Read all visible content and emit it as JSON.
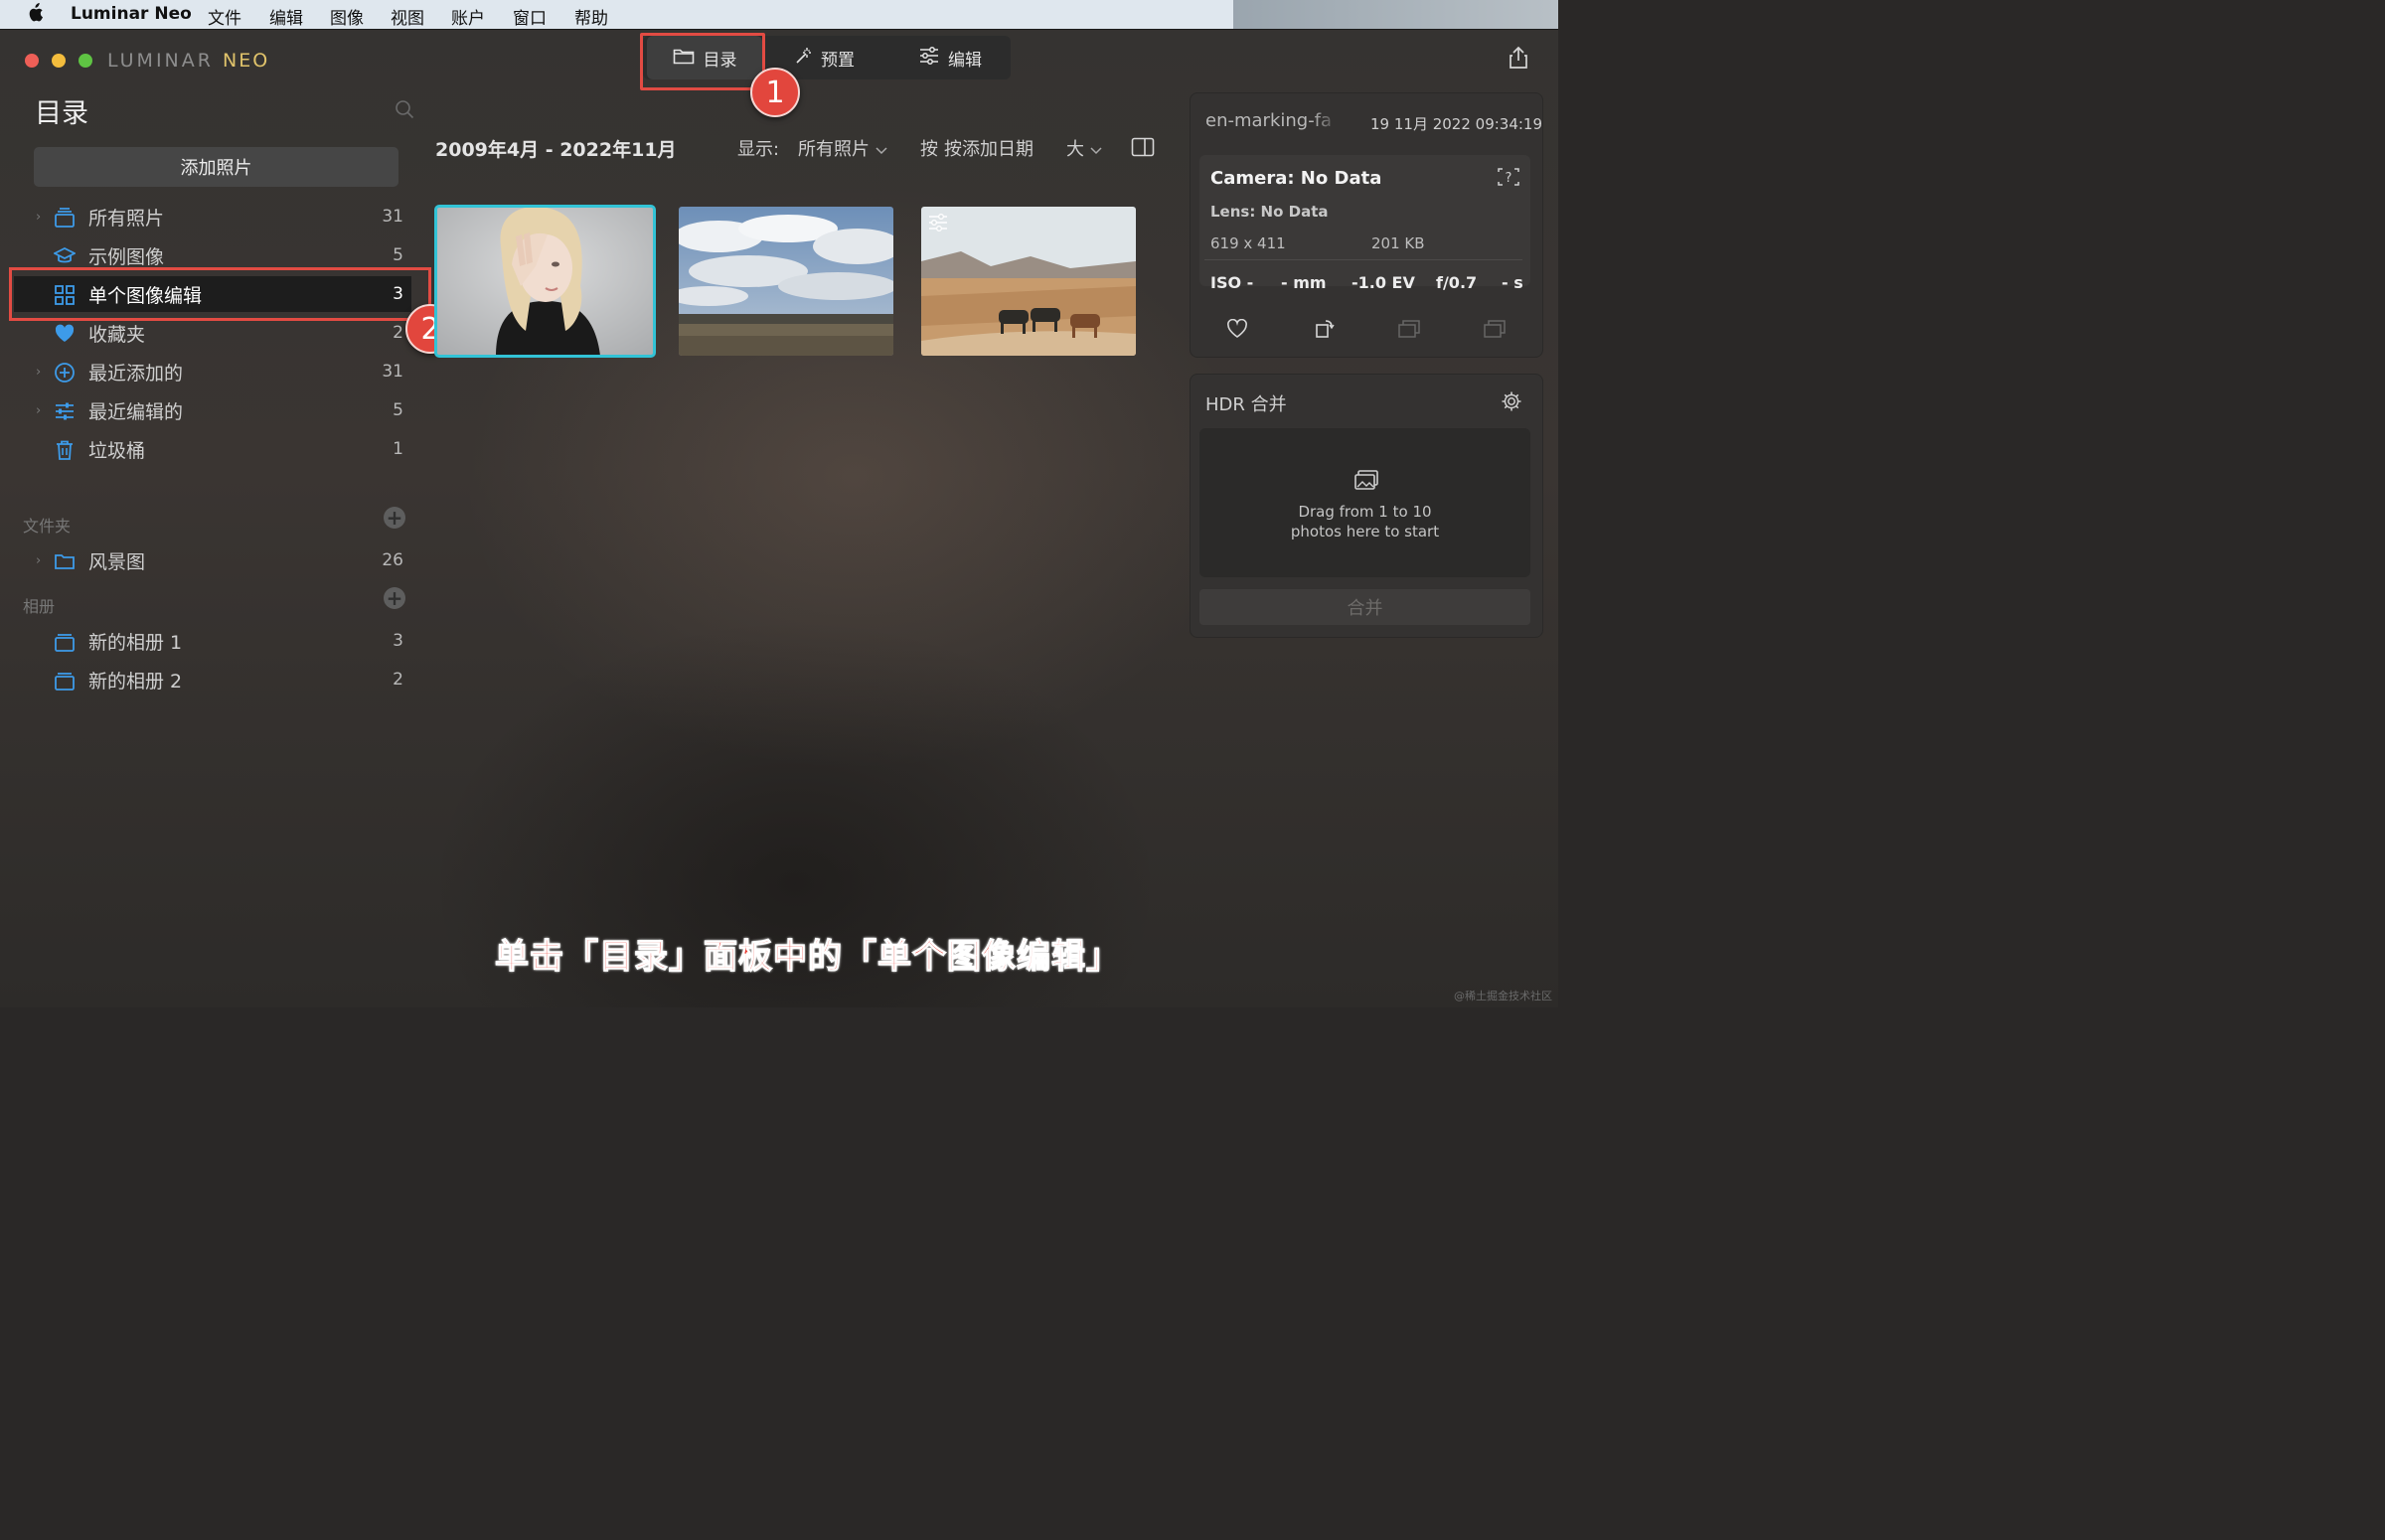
{
  "menubar": {
    "app": "Luminar Neo",
    "items": [
      "文件",
      "编辑",
      "图像",
      "视图",
      "账户",
      "窗口",
      "帮助"
    ]
  },
  "logo": {
    "part1": "LUMINAR ",
    "part2": "NEO"
  },
  "tabs": [
    {
      "label": "目录",
      "icon": "folder-icon",
      "active": true
    },
    {
      "label": "预置",
      "icon": "magic-wand-icon",
      "active": false
    },
    {
      "label": "编辑",
      "icon": "sliders-icon",
      "active": false
    }
  ],
  "annotations": {
    "badge1": "1",
    "badge2": "2"
  },
  "sidebar": {
    "title": "目录",
    "add_button": "添加照片",
    "items": [
      {
        "label": "所有照片",
        "count": "31",
        "icon": "photos-stack-icon",
        "has_chevron": true
      },
      {
        "label": "示例图像",
        "count": "5",
        "icon": "graduation-cap-icon",
        "has_chevron": false
      },
      {
        "label": "单个图像编辑",
        "count": "3",
        "icon": "grid-icon",
        "has_chevron": false,
        "selected": true
      },
      {
        "label": "收藏夹",
        "count": "2",
        "icon": "heart-icon",
        "has_chevron": false
      },
      {
        "label": "最近添加的",
        "count": "31",
        "icon": "plus-circle-icon",
        "has_chevron": true
      },
      {
        "label": "最近编辑的",
        "count": "5",
        "icon": "sliders-icon",
        "has_chevron": true
      },
      {
        "label": "垃圾桶",
        "count": "1",
        "icon": "trash-icon",
        "has_chevron": false
      }
    ],
    "folders_section": "文件夹",
    "folders": [
      {
        "label": "风景图",
        "count": "26",
        "icon": "folder-icon"
      }
    ],
    "albums_section": "相册",
    "albums": [
      {
        "label": "新的相册 1",
        "count": "3",
        "icon": "album-icon"
      },
      {
        "label": "新的相册 2",
        "count": "2",
        "icon": "album-icon"
      }
    ]
  },
  "toolbar": {
    "date_range": "2009年4月 - 2022年11月",
    "show_label": "显示:",
    "show_value": "所有照片",
    "sort_prefix": "按",
    "sort_value": "按添加日期",
    "size_value": "大"
  },
  "thumbnails": [
    {
      "name": "portrait-woman",
      "selected": true
    },
    {
      "name": "cloudy-sky-landscape",
      "selected": false
    },
    {
      "name": "desert-cows",
      "selected": false,
      "edited": true
    }
  ],
  "info_panel": {
    "filename": "en-marking-fa",
    "datetime": "19 11月 2022 09:34:19",
    "camera": "Camera: No Data",
    "lens": "Lens: No Data",
    "dimensions": "619 x 411",
    "filesize": "201 KB",
    "iso": "ISO -",
    "focal": "- mm",
    "ev": "-1.0 EV",
    "aperture": "f/0.7",
    "shutter": "- s"
  },
  "hdr_panel": {
    "title": "HDR 合并",
    "drop_line1": "Drag from 1 to 10",
    "drop_line2": "photos here to start",
    "merge_button": "合并"
  },
  "caption": "单击「目录」面板中的「单个图像编辑」",
  "watermark": "@稀土掘金技术社区",
  "colors": {
    "accent_blue": "#3d9be9",
    "highlight_red": "#e24b43",
    "selection_cyan": "#32c3d6"
  }
}
